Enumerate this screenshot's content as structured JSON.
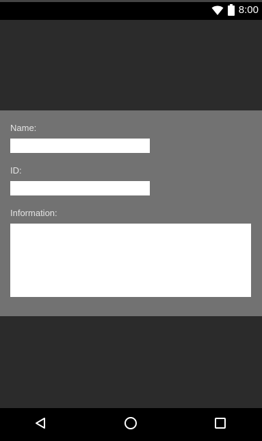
{
  "status_bar": {
    "time": "8:00",
    "icons": [
      "wifi-icon",
      "battery-icon"
    ]
  },
  "form": {
    "name_label": "Name:",
    "name_value": "",
    "id_label": "ID:",
    "id_value": "",
    "information_label": "Information:",
    "information_value": ""
  },
  "nav_bar": {
    "icons": [
      "back-icon",
      "home-icon",
      "recents-icon"
    ]
  },
  "colors": {
    "background": "#2b2b2b",
    "panel": "#727272",
    "label_text": "#e4e4e4",
    "bars": "#000000"
  }
}
